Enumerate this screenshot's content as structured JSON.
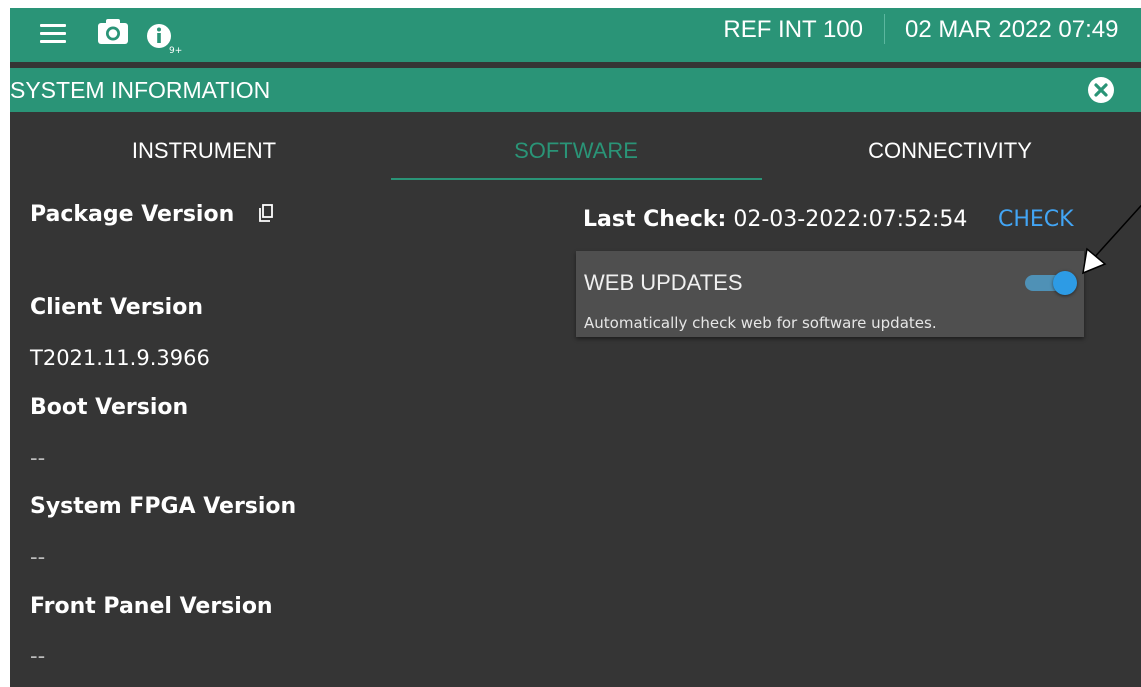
{
  "statusbar": {
    "reference": "REF INT 100",
    "datetime": "02 MAR 2022 07:49",
    "info_badge": "9+",
    "icons": [
      "menu-icon",
      "camera-icon",
      "info-icon"
    ]
  },
  "dialog": {
    "title": "SYSTEM INFORMATION",
    "close_icon": "close-icon"
  },
  "tabs": [
    {
      "label": "INSTRUMENT",
      "active": false
    },
    {
      "label": "SOFTWARE",
      "active": true
    },
    {
      "label": "CONNECTIVITY",
      "active": false
    }
  ],
  "software": {
    "fields": [
      {
        "label": "Package Version",
        "value": ""
      },
      {
        "label": "Client Version",
        "value": "T2021.11.9.3966"
      },
      {
        "label": "Boot Version",
        "value": "--"
      },
      {
        "label": "System FPGA Version",
        "value": "--"
      },
      {
        "label": "Front Panel Version",
        "value": "--"
      }
    ],
    "last_check_label": "Last Check:",
    "last_check_value": "02-03-2022:07:52:54",
    "check_button": "CHECK",
    "web_updates": {
      "title": "WEB UPDATES",
      "description": "Automatically check web for software updates.",
      "enabled": true
    }
  },
  "colors": {
    "accent": "#2a9477",
    "background": "#353535",
    "card": "#4f4f4f",
    "link": "#42a5f5",
    "toggle_on": "#2d9be5"
  }
}
